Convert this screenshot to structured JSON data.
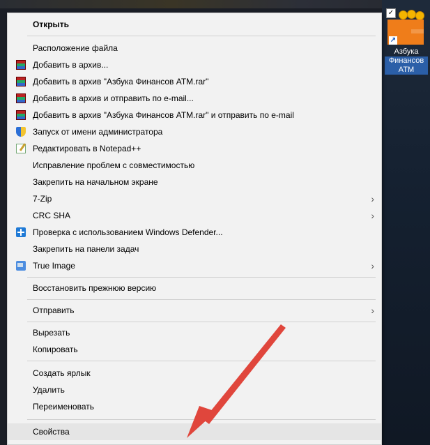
{
  "desktop": {
    "shortcut": {
      "label_line1": "Азбука",
      "label_line2": "Финансов",
      "label_line3": "ATM"
    }
  },
  "menu": {
    "items": [
      {
        "label": "Открыть"
      },
      {
        "label": "Расположение файла"
      },
      {
        "label": "Добавить в архив..."
      },
      {
        "label": "Добавить в архив \"Азбука Финансов ATM.rar\""
      },
      {
        "label": "Добавить в архив и отправить по e-mail..."
      },
      {
        "label": "Добавить в архив \"Азбука Финансов ATM.rar\" и отправить по e-mail"
      },
      {
        "label": "Запуск от имени администратора"
      },
      {
        "label": "Редактировать в Notepad++"
      },
      {
        "label": "Исправление проблем с совместимостью"
      },
      {
        "label": "Закрепить на начальном экране"
      },
      {
        "label": "7-Zip"
      },
      {
        "label": "CRC SHA"
      },
      {
        "label": "Проверка с использованием Windows Defender..."
      },
      {
        "label": "Закрепить на панели задач"
      },
      {
        "label": "True Image"
      },
      {
        "label": "Восстановить прежнюю версию"
      },
      {
        "label": "Отправить"
      },
      {
        "label": "Вырезать"
      },
      {
        "label": "Копировать"
      },
      {
        "label": "Создать ярлык"
      },
      {
        "label": "Удалить"
      },
      {
        "label": "Переименовать"
      },
      {
        "label": "Свойства"
      }
    ],
    "submenu_chevron": "›"
  },
  "colors": {
    "menu_bg": "#f2f2f2",
    "highlight": "#e5e5e5",
    "arrow": "#e0463c"
  }
}
